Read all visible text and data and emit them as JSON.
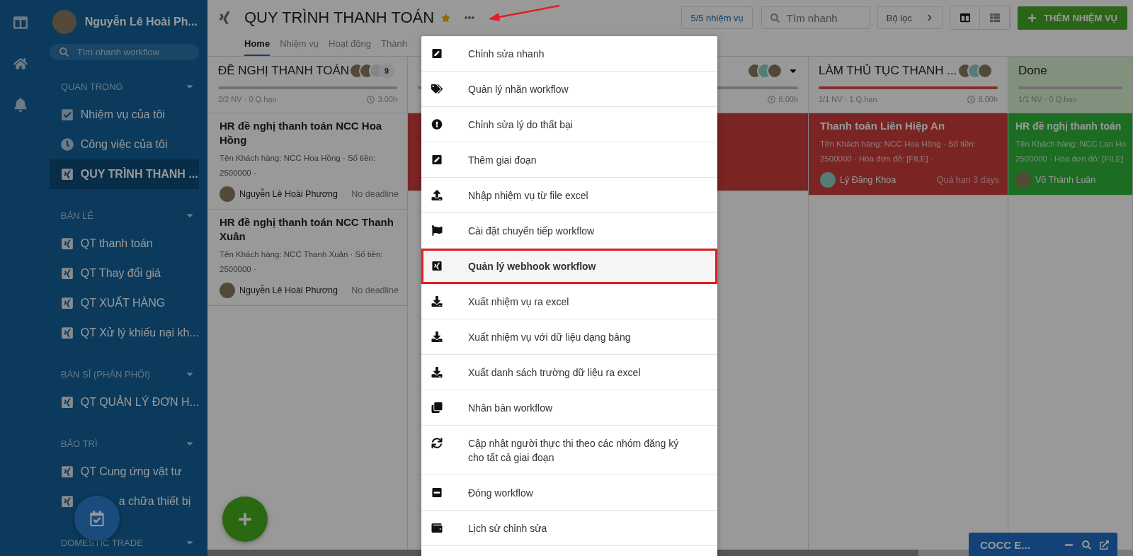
{
  "sidebar": {
    "user_name": "Nguyễn Lê Hoài Ph...",
    "search": {
      "placeholder": "Tìm nhanh workflow"
    },
    "sections": [
      {
        "title": "QUAN TRỌNG",
        "items": [
          {
            "label": "Nhiệm vụ của tôi",
            "kind": "tasks",
            "selected": false
          },
          {
            "label": "Công việc của tôi",
            "kind": "work",
            "selected": false
          },
          {
            "label": "QUY TRÌNH THANH ...",
            "kind": "workflow",
            "selected": true
          }
        ]
      },
      {
        "title": "BÁN LẺ",
        "items": [
          {
            "label": "QT thanh toán",
            "kind": "workflow",
            "selected": false
          },
          {
            "label": "QT Thay đổi giá",
            "kind": "workflow",
            "selected": false
          },
          {
            "label": "QT XUẤT HÀNG",
            "kind": "workflow",
            "selected": false
          },
          {
            "label": "QT Xử lý khiếu nại kh...",
            "kind": "workflow",
            "selected": false
          }
        ]
      },
      {
        "title": "BÁN SỈ (PHÂN PHỐI)",
        "items": [
          {
            "label": "QT QUẢN LÝ ĐƠN H...",
            "kind": "workflow",
            "selected": false
          }
        ]
      },
      {
        "title": "BẢO TRÌ",
        "items": [
          {
            "label": "QT Cung ứng vật tư",
            "kind": "workflow",
            "selected": false
          },
          {
            "label": "a chữa thiết bị",
            "kind": "workflow-covered",
            "selected": false
          }
        ]
      },
      {
        "title": "DOMESTIC TRADE"
      }
    ]
  },
  "header": {
    "title": "QUY TRÌNH THANH TOÁN",
    "starred": true,
    "tabs": [
      {
        "label": "Home",
        "selected": true
      },
      {
        "label": "Nhiệm vụ",
        "selected": false
      },
      {
        "label": "Hoạt động",
        "selected": false
      },
      {
        "label": "Thành",
        "selected": false
      }
    ],
    "task_count": "5/5 nhiệm vụ",
    "search": {
      "placeholder": "Tìm nhanh"
    },
    "filter": "Bộ lọc",
    "views": [
      {
        "kind": "board",
        "selected": true
      },
      {
        "kind": "list",
        "selected": false
      }
    ],
    "add_button": "THÊM NHIỆM VỤ"
  },
  "columns": [
    {
      "title": "ĐỀ NGHỊ THANH TOÁN",
      "kind": "normal",
      "avatars": [
        {
          "kind": "photo"
        },
        {
          "kind": "photo"
        },
        {
          "kind": "blank"
        }
      ],
      "member_count": "9",
      "stats": "2/2 NV · 0 Q.hạn",
      "hours": "3.00h",
      "cards": [
        {
          "kind": "normal",
          "title": "HR đề nghị thanh toán NCC Hoa Hồng",
          "description_lines": [
            "Tên Khách hàng: NCC Hoa Hồng · Số tiền:",
            "2500000 ·"
          ],
          "assignee": "Nguyễn Lê Hoài Phương",
          "due": "No deadline"
        },
        {
          "kind": "normal",
          "title": "HR đề nghị thanh toán NCC Thanh Xuân",
          "description_lines": [
            "Tên Khách hàng: NCC Thanh Xuân · Số tiền:",
            "2500000 ·"
          ],
          "assignee": "Nguyễn Lê Hoài Phương",
          "due": "No deadline"
        }
      ]
    },
    {
      "kind": "normal",
      "avatars": [
        {
          "kind": "photo"
        },
        {
          "kind": "default"
        },
        {
          "kind": "photo"
        }
      ],
      "hours": "8.00h",
      "cards": [
        {
          "kind": "overdue"
        }
      ]
    },
    {
      "title": "LÀM THỦ TỤC THANH ...",
      "kind": "overdue",
      "avatars": [
        {
          "kind": "photo"
        },
        {
          "kind": "default"
        },
        {
          "kind": "photo"
        }
      ],
      "stats": "1/1 NV · 1 Q.hạn",
      "hours": "8.00h",
      "cards": [
        {
          "kind": "overdue",
          "title": "Thanh toán Liên Hiệp An",
          "description_lines": [
            "Tên Khách hàng: NCC Hoa Hồng · Số tiền:",
            "2500000 · Hóa đơn đỏ: [FILE] ·"
          ],
          "assignee": "Lý Đăng Khoa",
          "due": "Quá hạn 3 days"
        }
      ]
    },
    {
      "title": "Done",
      "kind": "done",
      "stats": "1/1 NV · 0 Q.hạn",
      "cards": [
        {
          "kind": "done",
          "title": "HR đề nghị thanh toán",
          "description_lines": [
            "Tên Khách hàng: NCC Lan Ho",
            "2500000 · Hóa đơn đỏ: [FILE]"
          ],
          "assignee": "Võ Thành Luân"
        }
      ]
    }
  ],
  "menu": [
    {
      "label": "Chỉnh sửa nhanh",
      "selected": false
    },
    {
      "label": "Quản lý nhãn workflow",
      "selected": false
    },
    {
      "label": "Chỉnh sửa lý do thất bại",
      "selected": false
    },
    {
      "label": "Thêm giai đoạn",
      "selected": false
    },
    {
      "label": "Nhập nhiệm vụ từ file excel",
      "selected": false
    },
    {
      "label": "Cài đặt chuyển tiếp workflow",
      "selected": false
    },
    {
      "label": "Quản lý webhook workflow",
      "selected": true
    },
    {
      "label": "Xuất nhiệm vụ ra excel",
      "selected": false
    },
    {
      "label": "Xuất nhiệm vụ với dữ liệu dạng bảng",
      "selected": false
    },
    {
      "label": "Xuất danh sách trường dữ liệu ra excel",
      "selected": false
    },
    {
      "label": "Nhân bản workflow",
      "selected": false
    },
    {
      "label": "Cập nhật người thực thi theo các nhóm đăng ký cho tất cả giai đoạn",
      "selected": false
    },
    {
      "label": "Đóng workflow",
      "selected": false
    },
    {
      "label": "Lịch sử chỉnh sửa",
      "selected": false
    }
  ],
  "chat": {
    "title": "COCC E..."
  }
}
